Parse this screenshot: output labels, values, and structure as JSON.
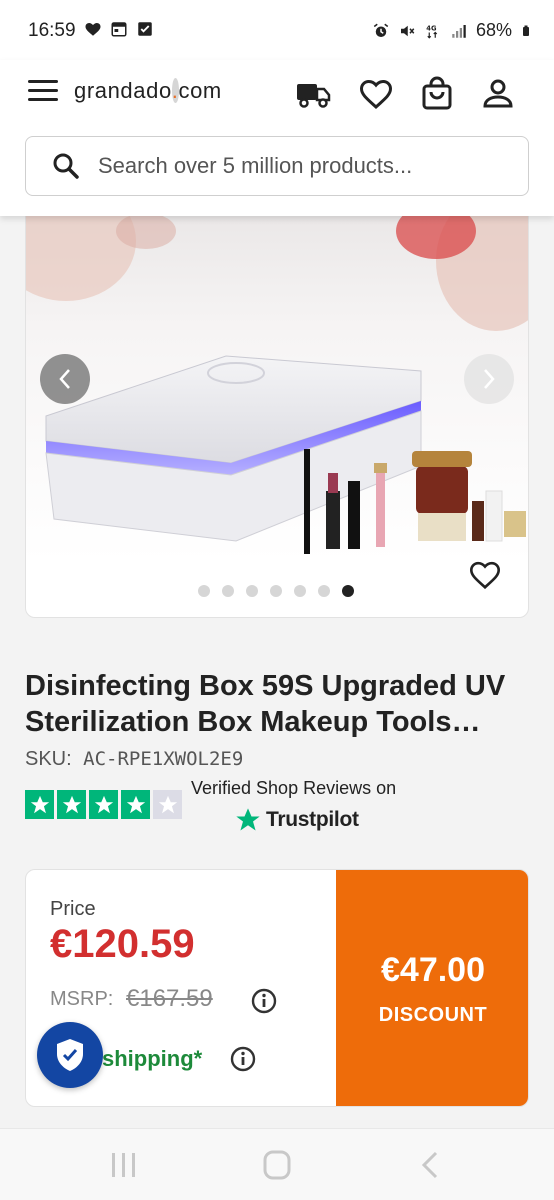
{
  "status_bar": {
    "time": "16:59",
    "battery": "68%",
    "network": "4G"
  },
  "header": {
    "logo_text": "grandado",
    "logo_dot": ".",
    "logo_tld": "com",
    "search_placeholder": "Search over 5 million products..."
  },
  "carousel": {
    "slide_count": 7,
    "active_index": 6
  },
  "product": {
    "title": "Disinfecting Box 59S Upgraded UV Sterilization Box Makeup Tools…",
    "sku_label": "SKU:",
    "sku": "AC-RPE1XWOL2E9",
    "rating_stars": 4,
    "reviews_text": "Verified Shop Reviews on",
    "trustpilot": "Trustpilot"
  },
  "pricing": {
    "price_label": "Price",
    "price": "€120.59",
    "msrp_label": "MSRP:",
    "msrp": "€167.59",
    "shipping": "shipping*",
    "discount_amount": "€47.00",
    "discount_label": "DISCOUNT"
  },
  "colors": {
    "accent": "#ee6c0a",
    "price": "#d22f2f",
    "trustpilot": "#00b67a",
    "badge": "#1346a3",
    "shipping": "#1d8a3a"
  }
}
